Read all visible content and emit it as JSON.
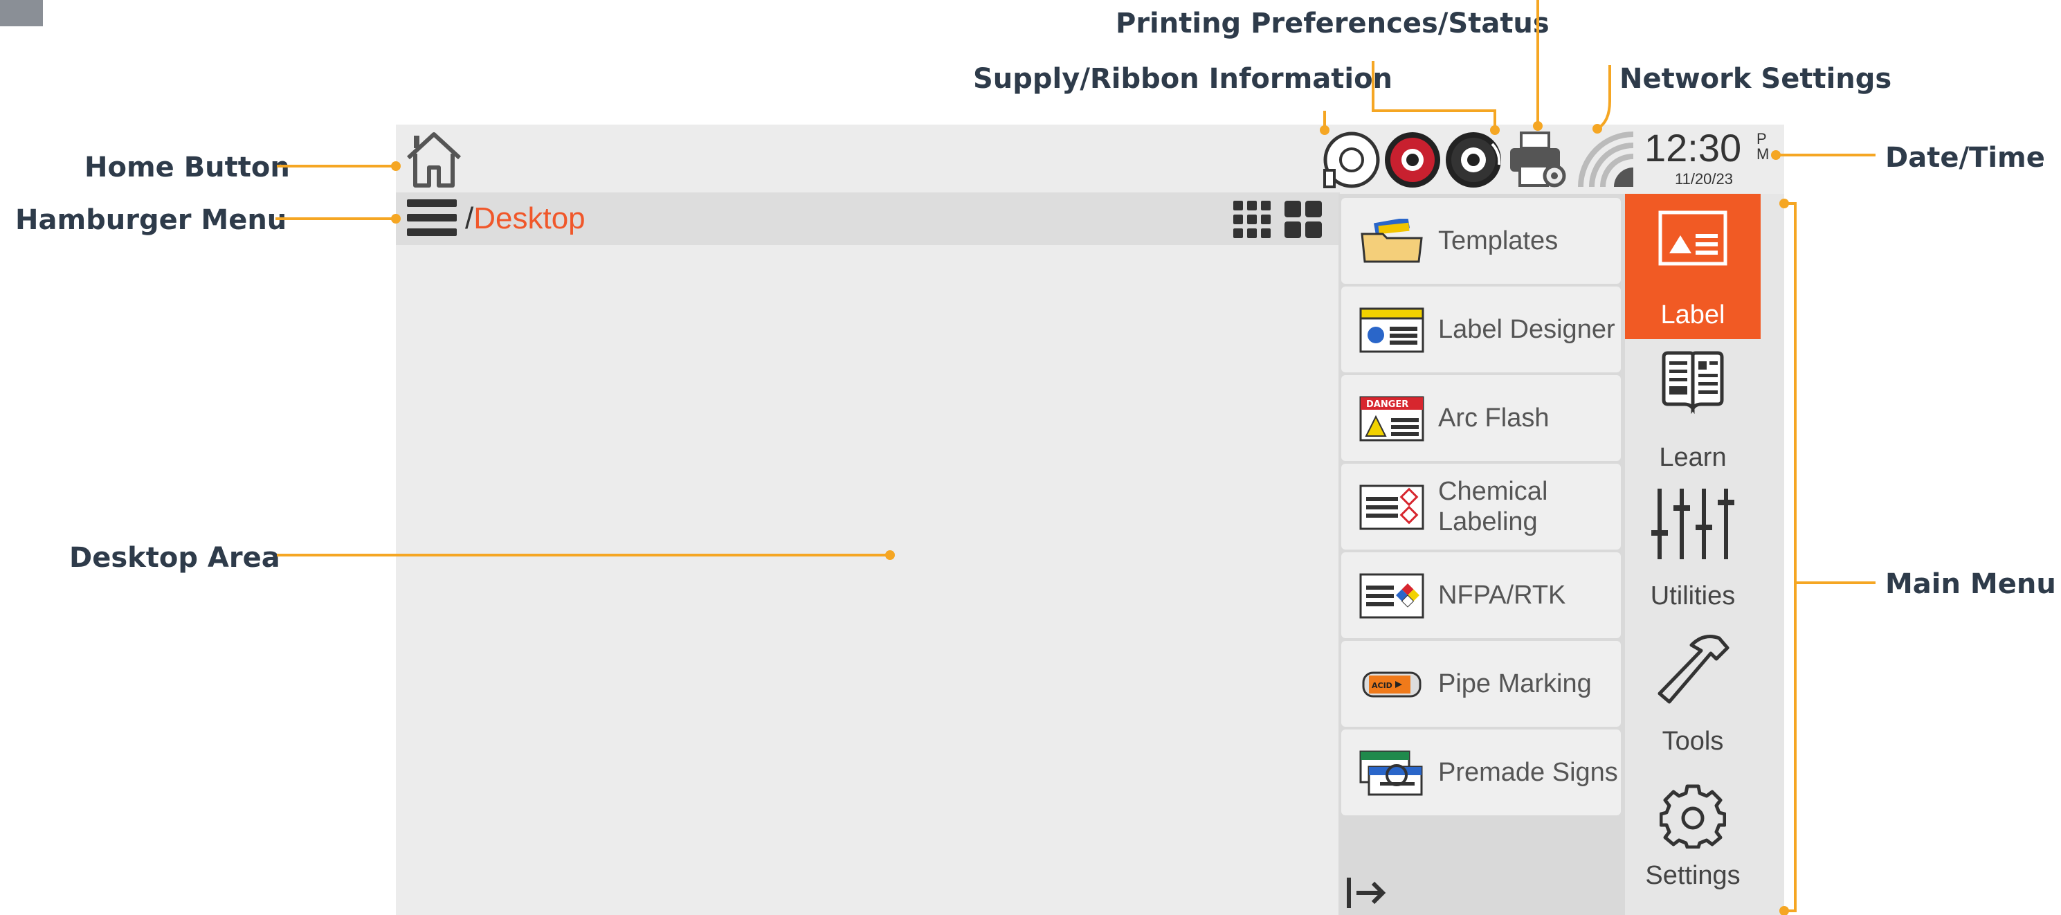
{
  "callouts": {
    "printing": "Printing Preferences/Status",
    "supply": "Supply/Ribbon Information",
    "network": "Network Settings",
    "home": "Home Button",
    "hamburger": "Hamburger Menu",
    "datetime": "Date/Time",
    "desktop": "Desktop Area",
    "mainmenu": "Main Menu"
  },
  "breadcrumb": {
    "slash": "/",
    "current": "Desktop"
  },
  "clock": {
    "time": "12:30",
    "am_pm_top": "P",
    "am_pm_bottom": "M",
    "date": "11/20/23"
  },
  "submenu": [
    {
      "label": "Templates",
      "icon": "templates-folder-icon"
    },
    {
      "label": "Label Designer",
      "icon": "label-designer-icon"
    },
    {
      "label": "Arc Flash",
      "icon": "arc-flash-icon"
    },
    {
      "label": "Chemical Labeling",
      "icon": "chemical-labeling-icon"
    },
    {
      "label": "NFPA/RTK",
      "icon": "nfpa-icon"
    },
    {
      "label": "Pipe Marking",
      "icon": "pipe-marking-icon"
    },
    {
      "label": "Premade Signs",
      "icon": "premade-signs-icon"
    }
  ],
  "mainmenu": [
    {
      "label": "Label",
      "icon": "label-icon",
      "active": true
    },
    {
      "label": "Learn",
      "icon": "book-icon",
      "active": false
    },
    {
      "label": "Utilities",
      "icon": "sliders-icon",
      "active": false
    },
    {
      "label": "Tools",
      "icon": "hammer-icon",
      "active": false
    },
    {
      "label": "Settings",
      "icon": "gear-icon",
      "active": false
    }
  ],
  "colors": {
    "accent": "#f15a24",
    "callout_line": "#f5a623",
    "callout_text": "#2e3b4a",
    "screen_bg": "#ececec"
  },
  "icon_labels": {
    "arc_flash_header": "DANGER",
    "pipe_tag": "ACID"
  }
}
